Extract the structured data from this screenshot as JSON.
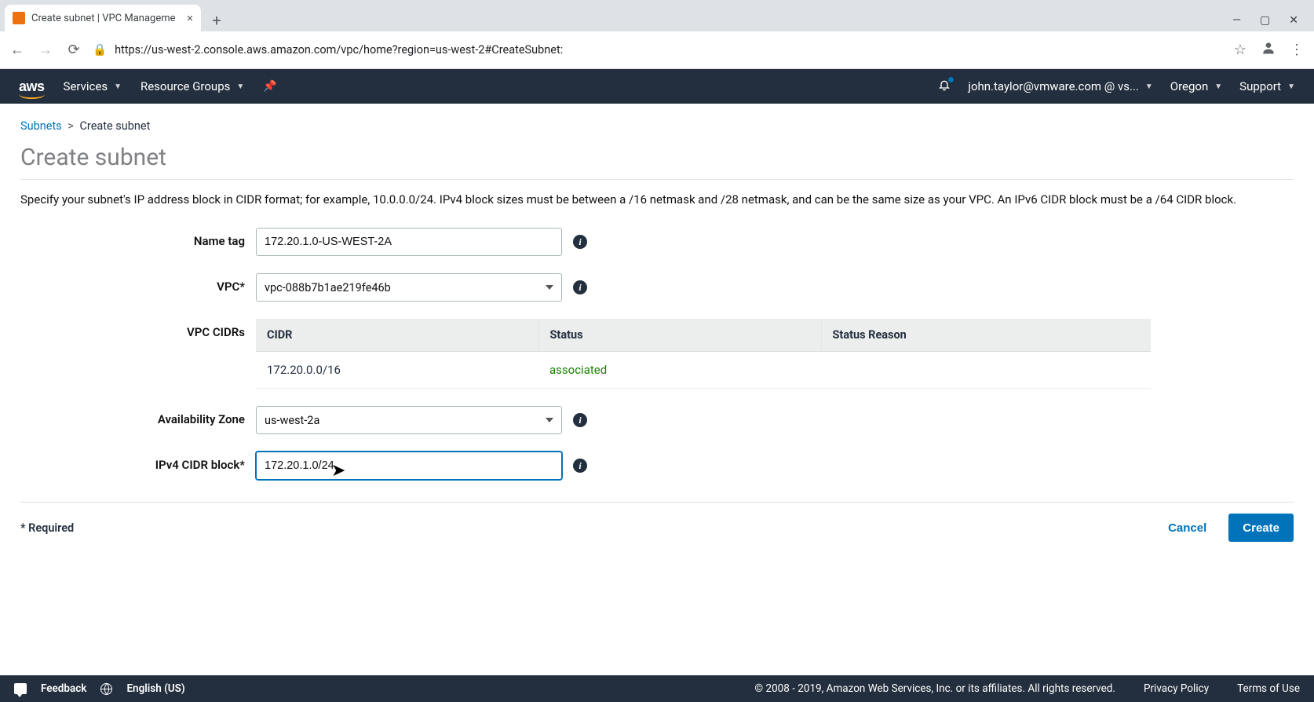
{
  "browser": {
    "tab_title": "Create subnet | VPC Manageme",
    "url": "https://us-west-2.console.aws.amazon.com/vpc/home?region=us-west-2#CreateSubnet:"
  },
  "nav": {
    "logo_text": "aws",
    "services": "Services",
    "resource_groups": "Resource Groups",
    "user": "john.taylor@vmware.com @ vs...",
    "region": "Oregon",
    "support": "Support"
  },
  "breadcrumb": {
    "root": "Subnets",
    "current": "Create subnet"
  },
  "page": {
    "title": "Create subnet",
    "description": "Specify your subnet's IP address block in CIDR format; for example, 10.0.0.0/24. IPv4 block sizes must be between a /16 netmask and /28 netmask, and can be the same size as your VPC. An IPv6 CIDR block must be a /64 CIDR block."
  },
  "form": {
    "name_tag_label": "Name tag",
    "name_tag_value": "172.20.1.0-US-WEST-2A",
    "vpc_label": "VPC*",
    "vpc_value": "vpc-088b7b1ae219fe46b",
    "vpc_cidrs_label": "VPC CIDRs",
    "cidr_table": {
      "headers": {
        "cidr": "CIDR",
        "status": "Status",
        "reason": "Status Reason"
      },
      "rows": [
        {
          "cidr": "172.20.0.0/16",
          "status": "associated",
          "reason": ""
        }
      ]
    },
    "az_label": "Availability Zone",
    "az_value": "us-west-2a",
    "ipv4_label": "IPv4 CIDR block*",
    "ipv4_value": "172.20.1.0/24"
  },
  "footer": {
    "required": "* Required",
    "cancel": "Cancel",
    "create": "Create"
  },
  "bottom": {
    "feedback": "Feedback",
    "language": "English (US)",
    "copyright": "© 2008 - 2019, Amazon Web Services, Inc. or its affiliates. All rights reserved.",
    "privacy": "Privacy Policy",
    "terms": "Terms of Use"
  }
}
